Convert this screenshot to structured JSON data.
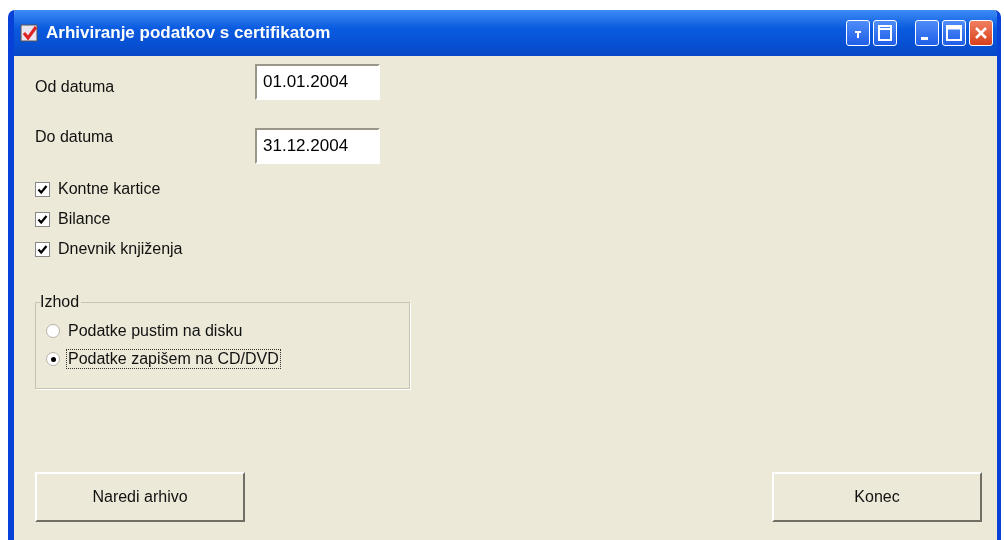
{
  "window": {
    "title": "Arhiviranje podatkov s certifikatom"
  },
  "date_fields": [
    {
      "label": "Od datuma",
      "value": "01.01.2004"
    },
    {
      "label": "Do datuma",
      "value": "31.12.2004"
    }
  ],
  "checkboxes": [
    {
      "label": "Kontne kartice",
      "checked": true
    },
    {
      "label": "Bilance",
      "checked": true
    },
    {
      "label": "Dnevnik knjiženja",
      "checked": true
    }
  ],
  "output_group": {
    "title": "Izhod",
    "options": [
      {
        "label": "Podatke pustim na disku",
        "selected": false
      },
      {
        "label": "Podatke zapišem na CD/DVD",
        "selected": true
      }
    ]
  },
  "buttons": [
    {
      "label": "Naredi arhivo"
    },
    {
      "label": "Konec"
    }
  ]
}
